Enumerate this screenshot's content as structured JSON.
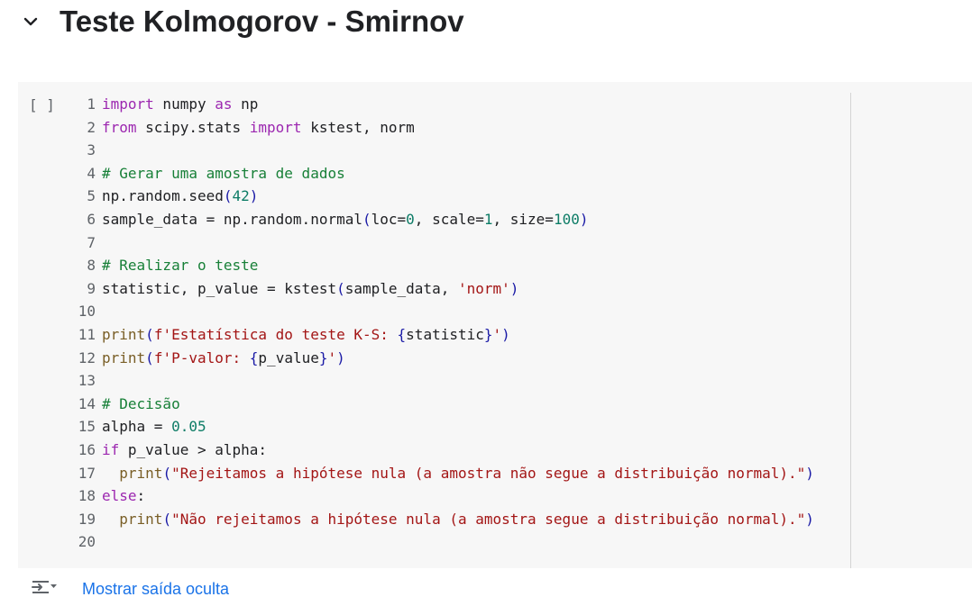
{
  "section": {
    "title": "Teste Kolmogorov - Smirnov",
    "chevron_icon": "chevron-down-icon"
  },
  "cell": {
    "run_indicator": "[ ]",
    "lines": [
      {
        "n": "1",
        "tokens": [
          [
            "kw",
            "import"
          ],
          [
            "id",
            " numpy "
          ],
          [
            "kw",
            "as"
          ],
          [
            "id",
            " np"
          ]
        ]
      },
      {
        "n": "2",
        "tokens": [
          [
            "kw",
            "from"
          ],
          [
            "id",
            " scipy.stats "
          ],
          [
            "kw",
            "import"
          ],
          [
            "id",
            " kstest, norm"
          ]
        ]
      },
      {
        "n": "3",
        "tokens": []
      },
      {
        "n": "4",
        "tokens": [
          [
            "cm",
            "# Gerar uma amostra de dados"
          ]
        ]
      },
      {
        "n": "5",
        "tokens": [
          [
            "id",
            "np.random.seed"
          ],
          [
            "br",
            "("
          ],
          [
            "num",
            "42"
          ],
          [
            "br",
            ")"
          ]
        ]
      },
      {
        "n": "6",
        "tokens": [
          [
            "id",
            "sample_data = np.random.normal"
          ],
          [
            "br",
            "("
          ],
          [
            "id",
            "loc="
          ],
          [
            "num",
            "0"
          ],
          [
            "id",
            ", scale="
          ],
          [
            "num",
            "1"
          ],
          [
            "id",
            ", size="
          ],
          [
            "num",
            "100"
          ],
          [
            "br",
            ")"
          ]
        ]
      },
      {
        "n": "7",
        "tokens": []
      },
      {
        "n": "8",
        "tokens": [
          [
            "cm",
            "# Realizar o teste"
          ]
        ]
      },
      {
        "n": "9",
        "tokens": [
          [
            "id",
            "statistic, p_value = kstest"
          ],
          [
            "br",
            "("
          ],
          [
            "id",
            "sample_data, "
          ],
          [
            "str",
            "'norm'"
          ],
          [
            "br",
            ")"
          ]
        ]
      },
      {
        "n": "10",
        "tokens": []
      },
      {
        "n": "11",
        "tokens": [
          [
            "fn",
            "print"
          ],
          [
            "br",
            "("
          ],
          [
            "str",
            "f'Estatística do teste K-S: "
          ],
          [
            "br",
            "{"
          ],
          [
            "id",
            "statistic"
          ],
          [
            "br",
            "}"
          ],
          [
            "str",
            "'"
          ],
          [
            "br",
            ")"
          ]
        ]
      },
      {
        "n": "12",
        "tokens": [
          [
            "fn",
            "print"
          ],
          [
            "br",
            "("
          ],
          [
            "str",
            "f'P-valor: "
          ],
          [
            "br",
            "{"
          ],
          [
            "id",
            "p_value"
          ],
          [
            "br",
            "}"
          ],
          [
            "str",
            "'"
          ],
          [
            "br",
            ")"
          ]
        ]
      },
      {
        "n": "13",
        "tokens": []
      },
      {
        "n": "14",
        "tokens": [
          [
            "cm",
            "# Decisão"
          ]
        ]
      },
      {
        "n": "15",
        "tokens": [
          [
            "id",
            "alpha = "
          ],
          [
            "num",
            "0.05"
          ]
        ]
      },
      {
        "n": "16",
        "tokens": [
          [
            "kw",
            "if"
          ],
          [
            "id",
            " p_value > alpha:"
          ]
        ]
      },
      {
        "n": "17",
        "tokens": [
          [
            "id",
            "  "
          ],
          [
            "fn",
            "print"
          ],
          [
            "br",
            "("
          ],
          [
            "str",
            "\"Rejeitamos a hipótese nula (a amostra não segue a distribuição normal).\""
          ],
          [
            "br",
            ")"
          ]
        ]
      },
      {
        "n": "18",
        "tokens": [
          [
            "kw",
            "else"
          ],
          [
            "id",
            ":"
          ]
        ]
      },
      {
        "n": "19",
        "tokens": [
          [
            "id",
            "  "
          ],
          [
            "fn",
            "print"
          ],
          [
            "br",
            "("
          ],
          [
            "str",
            "\"Não rejeitamos a hipótese nula (a amostra segue a distribuição normal).\""
          ],
          [
            "br",
            ")"
          ]
        ]
      },
      {
        "n": "20",
        "tokens": []
      }
    ]
  },
  "output": {
    "icon": "output-toggle-icon",
    "link_label": "Mostrar saída oculta"
  },
  "colors": {
    "keyword": "#9c27b0",
    "comment": "#188038",
    "number": "#0d7c66",
    "string": "#a31515",
    "bracket": "#1a1aa6",
    "link": "#1a73e8",
    "cell_background": "#f7f7f7"
  }
}
